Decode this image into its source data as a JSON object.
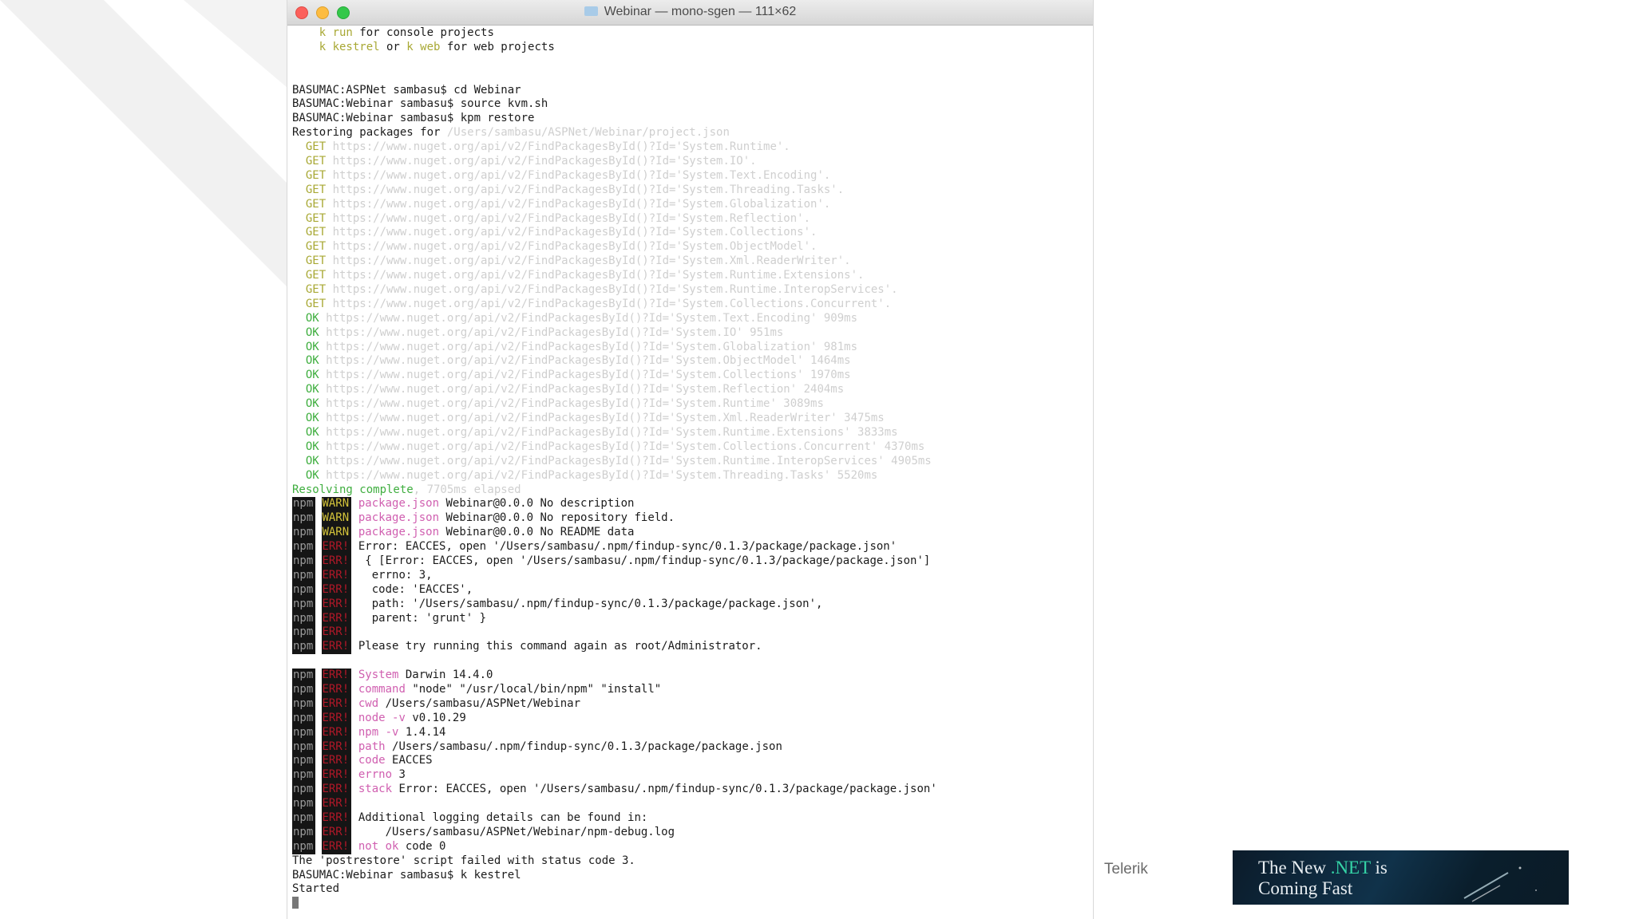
{
  "window": {
    "title": "Webinar — mono-sgen — 111×62"
  },
  "terminal": {
    "lines": [
      {
        "segments": [
          {
            "t": "    "
          },
          {
            "t": "k run",
            "c": "c-cmd"
          },
          {
            "t": " for console projects"
          }
        ]
      },
      {
        "segments": [
          {
            "t": "    "
          },
          {
            "t": "k kestrel",
            "c": "c-cmd"
          },
          {
            "t": " or "
          },
          {
            "t": "k web",
            "c": "c-cmd"
          },
          {
            "t": " for web projects"
          }
        ]
      },
      {
        "segments": [
          {
            "t": ""
          }
        ]
      },
      {
        "segments": [
          {
            "t": ""
          }
        ]
      },
      {
        "segments": [
          {
            "t": "BASUMAC:ASPNet sambasu$ cd Webinar"
          }
        ]
      },
      {
        "segments": [
          {
            "t": "BASUMAC:Webinar sambasu$ source kvm.sh"
          }
        ]
      },
      {
        "segments": [
          {
            "t": "BASUMAC:Webinar sambasu$ kpm restore"
          }
        ]
      },
      {
        "segments": [
          {
            "t": "Restoring packages for "
          },
          {
            "t": "/Users/sambasu/ASPNet/Webinar/project.json",
            "c": "c-faint"
          }
        ]
      },
      {
        "segments": [
          {
            "t": "  "
          },
          {
            "t": "GET",
            "c": "c-get"
          },
          {
            "t": " https://www.nuget.org/api/v2/FindPackagesById()?Id='System.Runtime'.",
            "c": "c-faint"
          }
        ]
      },
      {
        "segments": [
          {
            "t": "  "
          },
          {
            "t": "GET",
            "c": "c-get"
          },
          {
            "t": " https://www.nuget.org/api/v2/FindPackagesById()?Id='System.IO'.",
            "c": "c-faint"
          }
        ]
      },
      {
        "segments": [
          {
            "t": "  "
          },
          {
            "t": "GET",
            "c": "c-get"
          },
          {
            "t": " https://www.nuget.org/api/v2/FindPackagesById()?Id='System.Text.Encoding'.",
            "c": "c-faint"
          }
        ]
      },
      {
        "segments": [
          {
            "t": "  "
          },
          {
            "t": "GET",
            "c": "c-get"
          },
          {
            "t": " https://www.nuget.org/api/v2/FindPackagesById()?Id='System.Threading.Tasks'.",
            "c": "c-faint"
          }
        ]
      },
      {
        "segments": [
          {
            "t": "  "
          },
          {
            "t": "GET",
            "c": "c-get"
          },
          {
            "t": " https://www.nuget.org/api/v2/FindPackagesById()?Id='System.Globalization'.",
            "c": "c-faint"
          }
        ]
      },
      {
        "segments": [
          {
            "t": "  "
          },
          {
            "t": "GET",
            "c": "c-get"
          },
          {
            "t": " https://www.nuget.org/api/v2/FindPackagesById()?Id='System.Reflection'.",
            "c": "c-faint"
          }
        ]
      },
      {
        "segments": [
          {
            "t": "  "
          },
          {
            "t": "GET",
            "c": "c-get"
          },
          {
            "t": " https://www.nuget.org/api/v2/FindPackagesById()?Id='System.Collections'.",
            "c": "c-faint"
          }
        ]
      },
      {
        "segments": [
          {
            "t": "  "
          },
          {
            "t": "GET",
            "c": "c-get"
          },
          {
            "t": " https://www.nuget.org/api/v2/FindPackagesById()?Id='System.ObjectModel'.",
            "c": "c-faint"
          }
        ]
      },
      {
        "segments": [
          {
            "t": "  "
          },
          {
            "t": "GET",
            "c": "c-get"
          },
          {
            "t": " https://www.nuget.org/api/v2/FindPackagesById()?Id='System.Xml.ReaderWriter'.",
            "c": "c-faint"
          }
        ]
      },
      {
        "segments": [
          {
            "t": "  "
          },
          {
            "t": "GET",
            "c": "c-get"
          },
          {
            "t": " https://www.nuget.org/api/v2/FindPackagesById()?Id='System.Runtime.Extensions'.",
            "c": "c-faint"
          }
        ]
      },
      {
        "segments": [
          {
            "t": "  "
          },
          {
            "t": "GET",
            "c": "c-get"
          },
          {
            "t": " https://www.nuget.org/api/v2/FindPackagesById()?Id='System.Runtime.InteropServices'.",
            "c": "c-faint"
          }
        ]
      },
      {
        "segments": [
          {
            "t": "  "
          },
          {
            "t": "GET",
            "c": "c-get"
          },
          {
            "t": " https://www.nuget.org/api/v2/FindPackagesById()?Id='System.Collections.Concurrent'.",
            "c": "c-faint"
          }
        ]
      },
      {
        "segments": [
          {
            "t": "  "
          },
          {
            "t": "OK",
            "c": "c-ok"
          },
          {
            "t": " https://www.nuget.org/api/v2/FindPackagesById()?Id='System.Text.Encoding' 909ms",
            "c": "c-faint"
          }
        ]
      },
      {
        "segments": [
          {
            "t": "  "
          },
          {
            "t": "OK",
            "c": "c-ok"
          },
          {
            "t": " https://www.nuget.org/api/v2/FindPackagesById()?Id='System.IO' 951ms",
            "c": "c-faint"
          }
        ]
      },
      {
        "segments": [
          {
            "t": "  "
          },
          {
            "t": "OK",
            "c": "c-ok"
          },
          {
            "t": " https://www.nuget.org/api/v2/FindPackagesById()?Id='System.Globalization' 981ms",
            "c": "c-faint"
          }
        ]
      },
      {
        "segments": [
          {
            "t": "  "
          },
          {
            "t": "OK",
            "c": "c-ok"
          },
          {
            "t": " https://www.nuget.org/api/v2/FindPackagesById()?Id='System.ObjectModel' 1464ms",
            "c": "c-faint"
          }
        ]
      },
      {
        "segments": [
          {
            "t": "  "
          },
          {
            "t": "OK",
            "c": "c-ok"
          },
          {
            "t": " https://www.nuget.org/api/v2/FindPackagesById()?Id='System.Collections' 1970ms",
            "c": "c-faint"
          }
        ]
      },
      {
        "segments": [
          {
            "t": "  "
          },
          {
            "t": "OK",
            "c": "c-ok"
          },
          {
            "t": " https://www.nuget.org/api/v2/FindPackagesById()?Id='System.Reflection' 2404ms",
            "c": "c-faint"
          }
        ]
      },
      {
        "segments": [
          {
            "t": "  "
          },
          {
            "t": "OK",
            "c": "c-ok"
          },
          {
            "t": " https://www.nuget.org/api/v2/FindPackagesById()?Id='System.Runtime' 3089ms",
            "c": "c-faint"
          }
        ]
      },
      {
        "segments": [
          {
            "t": "  "
          },
          {
            "t": "OK",
            "c": "c-ok"
          },
          {
            "t": " https://www.nuget.org/api/v2/FindPackagesById()?Id='System.Xml.ReaderWriter' 3475ms",
            "c": "c-faint"
          }
        ]
      },
      {
        "segments": [
          {
            "t": "  "
          },
          {
            "t": "OK",
            "c": "c-ok"
          },
          {
            "t": " https://www.nuget.org/api/v2/FindPackagesById()?Id='System.Runtime.Extensions' 3833ms",
            "c": "c-faint"
          }
        ]
      },
      {
        "segments": [
          {
            "t": "  "
          },
          {
            "t": "OK",
            "c": "c-ok"
          },
          {
            "t": " https://www.nuget.org/api/v2/FindPackagesById()?Id='System.Collections.Concurrent' 4370ms",
            "c": "c-faint"
          }
        ]
      },
      {
        "segments": [
          {
            "t": "  "
          },
          {
            "t": "OK",
            "c": "c-ok"
          },
          {
            "t": " https://www.nuget.org/api/v2/FindPackagesById()?Id='System.Runtime.InteropServices' 4905ms",
            "c": "c-faint"
          }
        ]
      },
      {
        "segments": [
          {
            "t": "  "
          },
          {
            "t": "OK",
            "c": "c-ok"
          },
          {
            "t": " https://www.nuget.org/api/v2/FindPackagesById()?Id='System.Threading.Tasks' 5520ms",
            "c": "c-faint"
          }
        ]
      },
      {
        "segments": [
          {
            "t": "Resolving complete",
            "c": "c-green"
          },
          {
            "t": ", 7705ms elapsed",
            "c": "c-faint"
          }
        ]
      },
      {
        "segments": [
          {
            "t": "npm ",
            "c": "npm-tag"
          },
          {
            "t": " "
          },
          {
            "t": "WARN",
            "c": "warn-tag"
          },
          {
            "t": " "
          },
          {
            "t": "package.json",
            "c": "c-pink"
          },
          {
            "t": " Webinar@0.0.0 No description"
          }
        ]
      },
      {
        "segments": [
          {
            "t": "npm ",
            "c": "npm-tag"
          },
          {
            "t": " "
          },
          {
            "t": "WARN",
            "c": "warn-tag"
          },
          {
            "t": " "
          },
          {
            "t": "package.json",
            "c": "c-pink"
          },
          {
            "t": " Webinar@0.0.0 No repository field."
          }
        ]
      },
      {
        "segments": [
          {
            "t": "npm ",
            "c": "npm-tag"
          },
          {
            "t": " "
          },
          {
            "t": "WARN",
            "c": "warn-tag"
          },
          {
            "t": " "
          },
          {
            "t": "package.json",
            "c": "c-pink"
          },
          {
            "t": " Webinar@0.0.0 No README data"
          }
        ]
      },
      {
        "segments": [
          {
            "t": "npm ",
            "c": "npm-tag"
          },
          {
            "t": " "
          },
          {
            "t": "ERR!",
            "c": "err-tag"
          },
          {
            "t": " Error: EACCES, open '/Users/sambasu/.npm/findup-sync/0.1.3/package/package.json'"
          }
        ]
      },
      {
        "segments": [
          {
            "t": "npm ",
            "c": "npm-tag"
          },
          {
            "t": " "
          },
          {
            "t": "ERR!",
            "c": "err-tag"
          },
          {
            "t": "  { [Error: EACCES, open '/Users/sambasu/.npm/findup-sync/0.1.3/package/package.json']"
          }
        ]
      },
      {
        "segments": [
          {
            "t": "npm ",
            "c": "npm-tag"
          },
          {
            "t": " "
          },
          {
            "t": "ERR!",
            "c": "err-tag"
          },
          {
            "t": "   errno: 3,"
          }
        ]
      },
      {
        "segments": [
          {
            "t": "npm ",
            "c": "npm-tag"
          },
          {
            "t": " "
          },
          {
            "t": "ERR!",
            "c": "err-tag"
          },
          {
            "t": "   code: 'EACCES',"
          }
        ]
      },
      {
        "segments": [
          {
            "t": "npm ",
            "c": "npm-tag"
          },
          {
            "t": " "
          },
          {
            "t": "ERR!",
            "c": "err-tag"
          },
          {
            "t": "   path: '/Users/sambasu/.npm/findup-sync/0.1.3/package/package.json',"
          }
        ]
      },
      {
        "segments": [
          {
            "t": "npm ",
            "c": "npm-tag"
          },
          {
            "t": " "
          },
          {
            "t": "ERR!",
            "c": "err-tag"
          },
          {
            "t": "   parent: 'grunt' }"
          }
        ]
      },
      {
        "segments": [
          {
            "t": "npm ",
            "c": "npm-tag"
          },
          {
            "t": " "
          },
          {
            "t": "ERR!",
            "c": "err-tag"
          },
          {
            "t": ""
          }
        ]
      },
      {
        "segments": [
          {
            "t": "npm ",
            "c": "npm-tag"
          },
          {
            "t": " "
          },
          {
            "t": "ERR!",
            "c": "err-tag"
          },
          {
            "t": " Please try running this command again as root/Administrator."
          }
        ]
      },
      {
        "segments": [
          {
            "t": ""
          }
        ]
      },
      {
        "segments": [
          {
            "t": "npm ",
            "c": "npm-tag"
          },
          {
            "t": " "
          },
          {
            "t": "ERR!",
            "c": "err-tag"
          },
          {
            "t": " "
          },
          {
            "t": "System",
            "c": "c-pink"
          },
          {
            "t": " Darwin 14.4.0"
          }
        ]
      },
      {
        "segments": [
          {
            "t": "npm ",
            "c": "npm-tag"
          },
          {
            "t": " "
          },
          {
            "t": "ERR!",
            "c": "err-tag"
          },
          {
            "t": " "
          },
          {
            "t": "command",
            "c": "c-pink"
          },
          {
            "t": " \"node\" \"/usr/local/bin/npm\" \"install\""
          }
        ]
      },
      {
        "segments": [
          {
            "t": "npm ",
            "c": "npm-tag"
          },
          {
            "t": " "
          },
          {
            "t": "ERR!",
            "c": "err-tag"
          },
          {
            "t": " "
          },
          {
            "t": "cwd",
            "c": "c-pink"
          },
          {
            "t": " /Users/sambasu/ASPNet/Webinar"
          }
        ]
      },
      {
        "segments": [
          {
            "t": "npm ",
            "c": "npm-tag"
          },
          {
            "t": " "
          },
          {
            "t": "ERR!",
            "c": "err-tag"
          },
          {
            "t": " "
          },
          {
            "t": "node -v",
            "c": "c-pink"
          },
          {
            "t": " v0.10.29"
          }
        ]
      },
      {
        "segments": [
          {
            "t": "npm ",
            "c": "npm-tag"
          },
          {
            "t": " "
          },
          {
            "t": "ERR!",
            "c": "err-tag"
          },
          {
            "t": " "
          },
          {
            "t": "npm -v",
            "c": "c-pink"
          },
          {
            "t": " 1.4.14"
          }
        ]
      },
      {
        "segments": [
          {
            "t": "npm ",
            "c": "npm-tag"
          },
          {
            "t": " "
          },
          {
            "t": "ERR!",
            "c": "err-tag"
          },
          {
            "t": " "
          },
          {
            "t": "path",
            "c": "c-pink"
          },
          {
            "t": " /Users/sambasu/.npm/findup-sync/0.1.3/package/package.json"
          }
        ]
      },
      {
        "segments": [
          {
            "t": "npm ",
            "c": "npm-tag"
          },
          {
            "t": " "
          },
          {
            "t": "ERR!",
            "c": "err-tag"
          },
          {
            "t": " "
          },
          {
            "t": "code",
            "c": "c-pink"
          },
          {
            "t": " EACCES"
          }
        ]
      },
      {
        "segments": [
          {
            "t": "npm ",
            "c": "npm-tag"
          },
          {
            "t": " "
          },
          {
            "t": "ERR!",
            "c": "err-tag"
          },
          {
            "t": " "
          },
          {
            "t": "errno",
            "c": "c-pink"
          },
          {
            "t": " 3"
          }
        ]
      },
      {
        "segments": [
          {
            "t": "npm ",
            "c": "npm-tag"
          },
          {
            "t": " "
          },
          {
            "t": "ERR!",
            "c": "err-tag"
          },
          {
            "t": " "
          },
          {
            "t": "stack",
            "c": "c-pink"
          },
          {
            "t": " Error: EACCES, open '/Users/sambasu/.npm/findup-sync/0.1.3/package/package.json'"
          }
        ]
      },
      {
        "segments": [
          {
            "t": "npm ",
            "c": "npm-tag"
          },
          {
            "t": " "
          },
          {
            "t": "ERR!",
            "c": "err-tag"
          },
          {
            "t": ""
          }
        ]
      },
      {
        "segments": [
          {
            "t": "npm ",
            "c": "npm-tag"
          },
          {
            "t": " "
          },
          {
            "t": "ERR!",
            "c": "err-tag"
          },
          {
            "t": " Additional logging details can be found in:"
          }
        ]
      },
      {
        "segments": [
          {
            "t": "npm ",
            "c": "npm-tag"
          },
          {
            "t": " "
          },
          {
            "t": "ERR!",
            "c": "err-tag"
          },
          {
            "t": "     /Users/sambasu/ASPNet/Webinar/npm-debug.log"
          }
        ]
      },
      {
        "segments": [
          {
            "t": "npm ",
            "c": "npm-tag"
          },
          {
            "t": " "
          },
          {
            "t": "ERR!",
            "c": "err-tag"
          },
          {
            "t": " "
          },
          {
            "t": "not ok",
            "c": "c-pink"
          },
          {
            "t": " code 0"
          }
        ]
      },
      {
        "segments": [
          {
            "t": "The 'postrestore' script failed with status code 3."
          }
        ]
      },
      {
        "segments": [
          {
            "t": "BASUMAC:Webinar sambasu$ k kestrel"
          }
        ]
      },
      {
        "segments": [
          {
            "t": "Started"
          }
        ]
      }
    ]
  },
  "footer": {
    "brand": "Telerik",
    "banner": {
      "line1_a": "The New ",
      "line1_net": ".NET",
      "line1_b": " is",
      "line2": "Coming Fast"
    }
  },
  "colors": {
    "terminal_bg": "#ffffff",
    "npm_tag_bg": "#151515",
    "banner_bg": "#0b1b2a",
    "net_accent": "#34d3a6"
  }
}
